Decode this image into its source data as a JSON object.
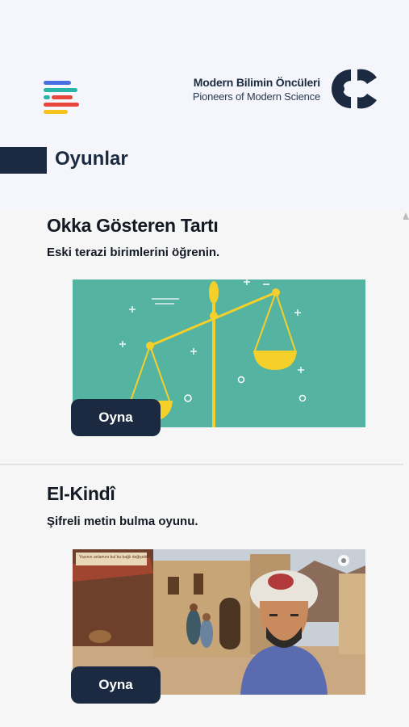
{
  "header": {
    "brand_title": "Modern Bilimin Öncüleri",
    "brand_subtitle": "Pioneers of Modern Science",
    "menu_colors": [
      "#4a6fe3",
      "#2bb5a8",
      "#e8453c",
      "#f6c21c"
    ]
  },
  "section": {
    "title": "Oyunlar"
  },
  "games": [
    {
      "title": "Okka Gösteren Tartı",
      "description": "Eski terazi birimlerini öğrenin.",
      "button": "Oyna",
      "image": "balance-scale-illustration",
      "bg_color": "#55b3a1",
      "accent_color": "#f5cf2a"
    },
    {
      "title": "El-Kindî",
      "description": "Şifreli metin bulma oyunu.",
      "button": "Oyna",
      "image": "el-kindi-bazaar-illustration",
      "sign_text": "Yazının anlamını bul bu bağlı değişebilir"
    }
  ],
  "colors": {
    "navy": "#1b2a41",
    "background": "#f4f6fb"
  }
}
